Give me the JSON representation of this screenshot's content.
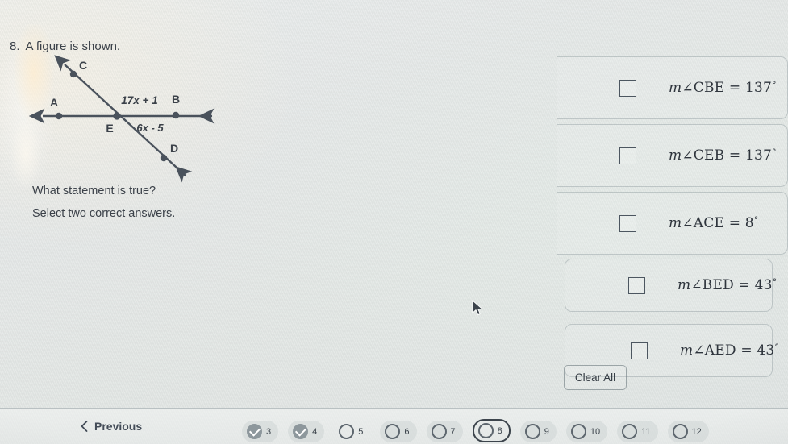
{
  "prompt": {
    "number": "8.",
    "text": "A figure is shown.",
    "question": "What statement is true?",
    "instruction": "Select two correct answers."
  },
  "figure": {
    "labels": {
      "A": "A",
      "B": "B",
      "C": "C",
      "D": "D",
      "E": "E"
    },
    "expressions": {
      "upper": "17x + 1",
      "lower": "6x - 5"
    },
    "line_color": "#4a525c"
  },
  "options": [
    {
      "id": "opt-cbe",
      "checked": false,
      "m": "m",
      "angle": "∠CBE",
      "eq": "=",
      "value": "137",
      "degree": "°"
    },
    {
      "id": "opt-ceb",
      "checked": false,
      "m": "m",
      "angle": "∠CEB",
      "eq": "=",
      "value": "137",
      "degree": "°"
    },
    {
      "id": "opt-ace",
      "checked": false,
      "m": "m",
      "angle": "∠ACE",
      "eq": "=",
      "value": "8",
      "degree": "°"
    },
    {
      "id": "opt-bed",
      "checked": false,
      "m": "m",
      "angle": "∠BED",
      "eq": "=",
      "value": "43",
      "degree": "°"
    },
    {
      "id": "opt-aed",
      "checked": false,
      "m": "m",
      "angle": "∠AED",
      "eq": "=",
      "value": "43",
      "degree": "°"
    }
  ],
  "actions": {
    "clear_all": "Clear All",
    "previous": "Previous"
  },
  "pager": {
    "items": [
      {
        "num": "3",
        "state": "done",
        "tinted": true
      },
      {
        "num": "4",
        "state": "done",
        "tinted": true
      },
      {
        "num": "5",
        "state": "empty",
        "tinted": false
      },
      {
        "num": "6",
        "state": "empty",
        "tinted": true
      },
      {
        "num": "7",
        "state": "empty",
        "tinted": true
      },
      {
        "num": "8",
        "state": "current",
        "tinted": false
      },
      {
        "num": "9",
        "state": "empty",
        "tinted": true
      },
      {
        "num": "10",
        "state": "empty",
        "tinted": true
      },
      {
        "num": "11",
        "state": "empty",
        "tinted": true
      },
      {
        "num": "12",
        "state": "empty",
        "tinted": true
      }
    ]
  },
  "colors": {
    "text": "#3b4149",
    "ink": "#2e343c",
    "pager_done": "#8d979c",
    "pager_outline": "#5d666e",
    "current_outline": "#3c444c"
  }
}
